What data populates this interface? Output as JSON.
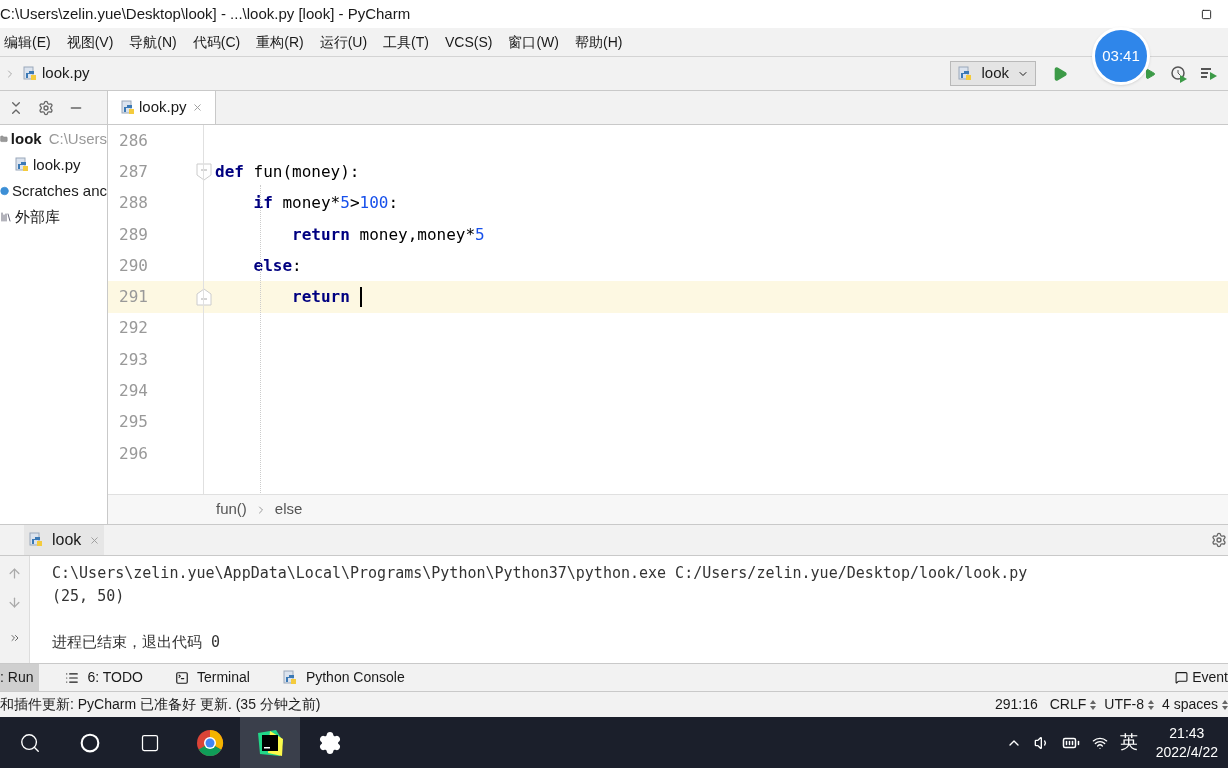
{
  "window": {
    "title": "C:\\Users\\zelin.yue\\Desktop\\look] - ...\\look.py [look] - PyCharm"
  },
  "menu": [
    "编辑(E)",
    "视图(V)",
    "导航(N)",
    "代码(C)",
    "重构(R)",
    "运行(U)",
    "工具(T)",
    "VCS(S)",
    "窗口(W)",
    "帮助(H)"
  ],
  "navbar": {
    "file": "look.py",
    "run_config": "look"
  },
  "timer": "03:41",
  "project": {
    "items": [
      {
        "kind": "folder",
        "label": "look",
        "detail": "C:\\Users"
      },
      {
        "kind": "pyfile",
        "label": "look.py"
      },
      {
        "kind": "scratch",
        "label": "Scratches anc"
      },
      {
        "kind": "library",
        "label": "外部库"
      }
    ]
  },
  "editor_tabs": [
    {
      "label": "look.py",
      "selected": true
    }
  ],
  "code": [
    {
      "number": "286",
      "selected": false,
      "kind": "plain"
    },
    {
      "number": "287",
      "selected": false,
      "kind": "fold_start",
      "tokens": [
        {
          "kind": "keyword",
          "text": "def"
        },
        {
          "kind": "plain",
          "text": " fun(money):"
        }
      ]
    },
    {
      "number": "288",
      "selected": false,
      "kind": "plain",
      "tokens": [
        {
          "kind": "keyword",
          "text": "    if"
        },
        {
          "kind": "plain",
          "text": " money*"
        },
        {
          "kind": "number",
          "text": "5"
        },
        {
          "kind": "plain",
          "text": ">"
        },
        {
          "kind": "number",
          "text": "100"
        },
        {
          "kind": "plain",
          "text": ":"
        }
      ]
    },
    {
      "number": "289",
      "selected": false,
      "kind": "plain",
      "tokens": [
        {
          "kind": "keyword",
          "text": "        return"
        },
        {
          "kind": "plain",
          "text": " money,money*"
        },
        {
          "kind": "number",
          "text": "5"
        }
      ]
    },
    {
      "number": "290",
      "selected": false,
      "kind": "plain",
      "tokens": [
        {
          "kind": "keyword",
          "text": "    else"
        },
        {
          "kind": "plain",
          "text": ":"
        }
      ]
    },
    {
      "number": "291",
      "selected": true,
      "kind": "fold_end",
      "tokens": [
        {
          "kind": "keyword",
          "text": "        return"
        }
      ]
    },
    {
      "number": "292",
      "selected": false,
      "kind": "plain"
    },
    {
      "number": "293",
      "selected": false,
      "kind": "plain"
    },
    {
      "number": "294",
      "selected": false,
      "kind": "plain"
    },
    {
      "number": "295",
      "selected": false,
      "kind": "plain"
    },
    {
      "number": "296",
      "selected": false,
      "kind": "plain"
    }
  ],
  "breadcrumb": [
    "fun()",
    "else"
  ],
  "run_panel": {
    "tab": "look",
    "lines": [
      "C:\\Users\\zelin.yue\\AppData\\Local\\Programs\\Python\\Python37\\python.exe C:/Users/zelin.yue/Desktop/look/look.py",
      "(25, 50)"
    ],
    "exit_message": "进程已结束，退出代码 0"
  },
  "tool_tabs": [
    {
      "label": ": Run",
      "selected": true,
      "kind": "run"
    },
    {
      "label": "6: TODO",
      "selected": false,
      "kind": "todo"
    },
    {
      "label": "Terminal",
      "selected": false,
      "kind": "terminal"
    },
    {
      "label": "Python Console",
      "selected": false,
      "kind": "python"
    }
  ],
  "event_log": "Event",
  "status_bar": {
    "message": "和插件更新: PyCharm 已准备好 更新. (35 分钟之前)",
    "position": "291:16",
    "line_sep": "CRLF",
    "encoding": "UTF-8",
    "indent": "4 spaces"
  },
  "taskbar": {
    "apps": [
      {
        "kind": "search",
        "selected": false
      },
      {
        "kind": "cortana",
        "selected": false
      },
      {
        "kind": "taskview",
        "selected": false
      },
      {
        "kind": "chrome",
        "selected": false
      },
      {
        "kind": "pycharm",
        "selected": true
      },
      {
        "kind": "settings",
        "selected": false
      }
    ],
    "ime": "英",
    "time": "21:43",
    "date": "2022/4/22"
  }
}
